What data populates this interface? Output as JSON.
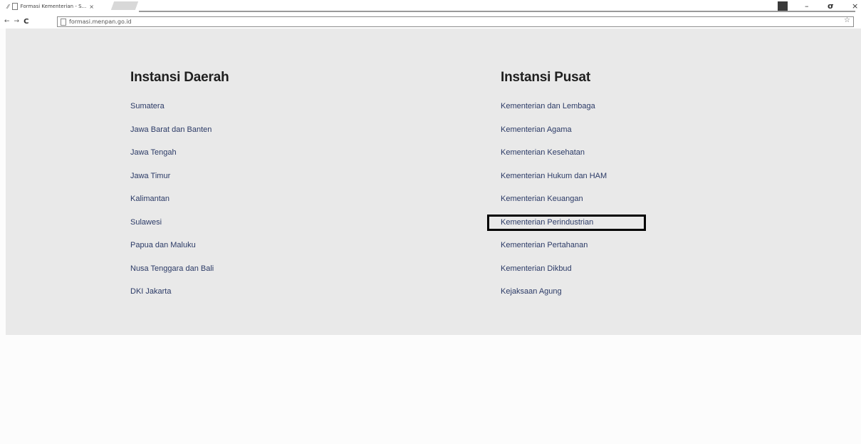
{
  "browser": {
    "tab_title": "Formasi Kementerian - S...",
    "address": "formasi.menpan.go.id",
    "nav": {
      "back": "←",
      "forward": "→",
      "reload": "C"
    },
    "window_controls": {
      "minimize": "–",
      "maximize": "σ",
      "close": "×"
    }
  },
  "regional": {
    "heading": "Instansi Daerah",
    "items": [
      "Sumatera",
      "Jawa Barat dan Banten",
      "Jawa Tengah",
      "Jawa Timur",
      "Kalimantan",
      "Sulawesi",
      "Papua dan Maluku",
      "Nusa Tenggara dan Bali",
      "DKI Jakarta"
    ]
  },
  "central": {
    "heading": "Instansi Pusat",
    "items": [
      "Kementerian dan Lembaga",
      "Kementerian Agama",
      "Kementerian Kesehatan",
      "Kementerian Hukum dan HAM",
      "Kementerian Keuangan",
      "Kementerian Perindustrian",
      "Kementerian Pertahanan",
      "Kementerian Dikbud",
      "Kejaksaan Agung"
    ]
  }
}
